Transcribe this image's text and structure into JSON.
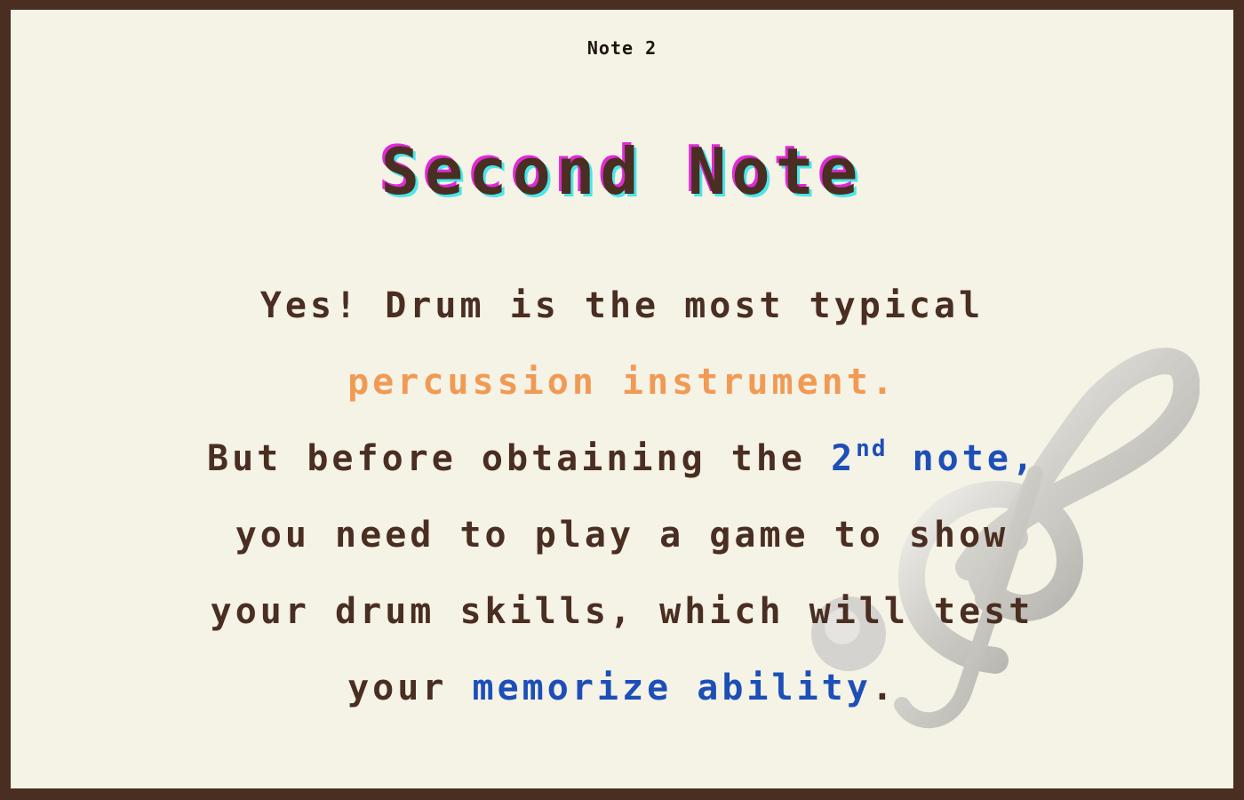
{
  "header": {
    "note_label": "Note 2"
  },
  "title": "Second Note",
  "paragraph": {
    "line1": "Yes! Drum is the most typical",
    "line2_highlight": "percussion instrument.",
    "line3_prefix": "But before obtaining the ",
    "line3_number": "2",
    "line3_superscript": "nd",
    "line3_highlight": " note,",
    "line4": "you need to play a game to show",
    "line5": "your drum skills, which will test",
    "line6_prefix": "your ",
    "line6_highlight": "memorize ability",
    "line6_suffix": "."
  },
  "decoration": {
    "clef_icon": "treble-clef-icon"
  },
  "colors": {
    "border": "#4a2e22",
    "background": "#f5f2e6",
    "text": "#4a2e22",
    "highlight_orange": "#f09a54",
    "highlight_blue": "#1d4fb8",
    "title_shadow_magenta": "#e02ad6",
    "title_shadow_cyan": "#49e6ea"
  }
}
